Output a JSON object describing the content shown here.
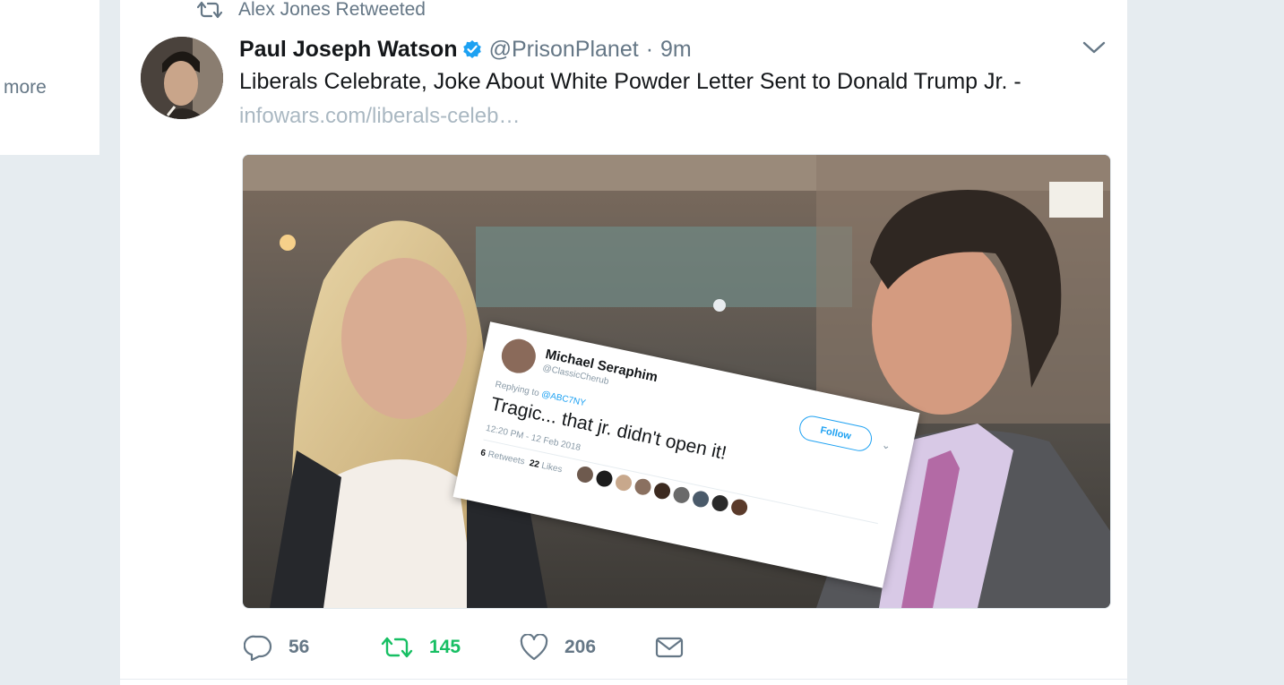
{
  "left_card": {
    "more_label": "more"
  },
  "retweet_context": {
    "icon": "retweet-icon",
    "text": "Alex Jones Retweeted"
  },
  "tweet": {
    "author_name": "Paul Joseph Watson",
    "verified": true,
    "handle": "@PrisonPlanet",
    "separator": "·",
    "time": "9m",
    "text": "Liberals Celebrate, Joke About White Powder Letter Sent to Donald Trump Jr. -",
    "link": "infowars.com/liberals-celeb…",
    "menu_icon": "chevron-down-icon"
  },
  "embedded_screenshot": {
    "name": "Michael Seraphim",
    "handle": "@ClassicCherub",
    "replying_prefix": "Replying to",
    "replying_to": "@ABC7NY",
    "follow_label": "Follow",
    "text": "Tragic... that jr. didn't open it!",
    "date": "12:20 PM - 12 Feb 2018",
    "retweets_count": "6",
    "retweets_label": "Retweets",
    "likes_count": "22",
    "likes_label": "Likes"
  },
  "actions": {
    "reply_count": "56",
    "retweet_count": "145",
    "like_count": "206",
    "reply_icon": "reply-icon",
    "retweet_icon": "retweet-icon",
    "like_icon": "heart-icon",
    "message_icon": "envelope-icon"
  },
  "colors": {
    "background": "#e6ecf0",
    "text_primary": "#14171a",
    "text_secondary": "#657786",
    "link": "#aab8c2",
    "verified": "#1da1f2",
    "retweet_active": "#17bf63"
  }
}
